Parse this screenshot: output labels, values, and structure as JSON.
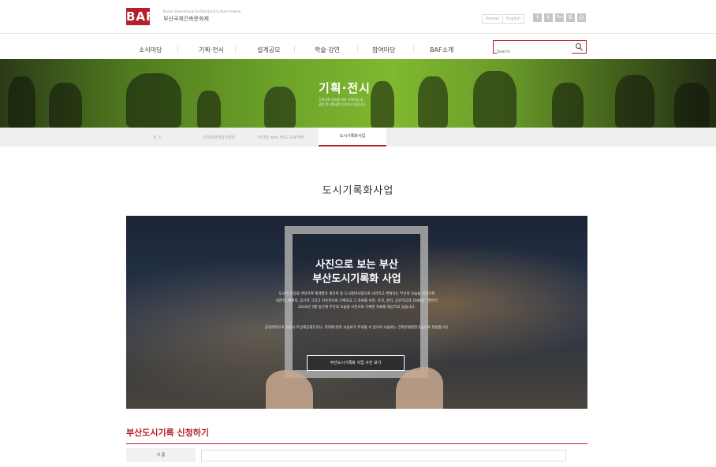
{
  "header": {
    "logo_text": "BAF",
    "logo_sub_en": "Busan International Architectural Culture Festival",
    "logo_sub_kr": "부산국제건축문화제",
    "lang_korean": "Korean",
    "lang_english": "English",
    "social": [
      "f",
      "t",
      "You",
      "B",
      "◎"
    ]
  },
  "nav": {
    "items": [
      "소식마당",
      "기획·전시",
      "설계공모",
      "학술·강연",
      "참여마당",
      "BAF소개"
    ],
    "search_placeholder": "Search"
  },
  "banner": {
    "title": "기획·전시",
    "subtitle_line1": "건축문화 전승을 위한 기획사업 및",
    "subtitle_line2": "관련 전시행사를 추진하고 있습니다."
  },
  "subtabs": {
    "items": [
      "전 시",
      "건축문화해설사양성",
      "HOPE with HUG 프로젝트"
    ],
    "active": "도시기록화사업"
  },
  "page": {
    "title": "도시기록화사업"
  },
  "promo": {
    "title_line1": "사진으로 보는 부산",
    "title_line2": "부산도시기록화 사업",
    "body_line1": "도시의 성장을 바탕하여 재개발과 재건축 등 도시정비사업으로 사라지고 변화하는 부산의 모습들 사진으로",
    "body_line2": "객관적, 체계적, 장기적 그리고 지속적으로 기록하고 그 자료를 보관, 유지, 관리, 공유하고자 2008년 7월부터",
    "body_line3": "2010년 3월 동안에 부산의 모습을 사진으로 기록한 자료를 제공하고 있습니다.",
    "note": "공익목적으로 사용시 무상제공해드리나, 목적에 따라 사용료가 부과될 수 있으며 사용료는 건축문화발전기금으로 적립합니다.",
    "button": "부산도시기록화 사업 사진 보기"
  },
  "form": {
    "title": "부산도시기록 신청하기",
    "name_label": "이 름"
  }
}
